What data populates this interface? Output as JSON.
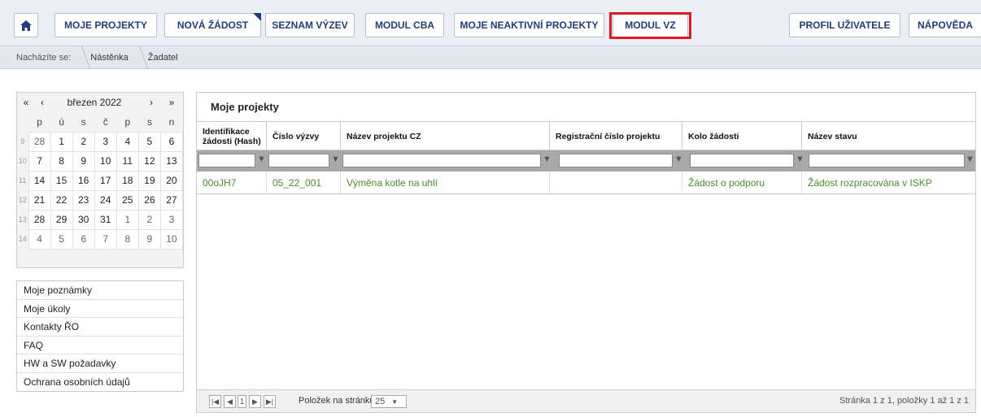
{
  "nav": {
    "home_icon": "home-icon",
    "items": [
      "MOJE PROJEKTY",
      "NOVÁ ŽÁDOST",
      "SEZNAM VÝZEV",
      "MODUL CBA",
      "MOJE NEAKTIVNÍ PROJEKTY",
      "MODUL VZ",
      "PROFIL UŽIVATELE",
      "NÁPOVĚDA"
    ],
    "highlight_color": "#e01b24"
  },
  "breadcrumb": {
    "prefix": "Nacházíte se:",
    "items": [
      "Nástěnka",
      "Žadatel"
    ]
  },
  "calendar": {
    "month": "březen 2022",
    "nav": [
      "«",
      "‹",
      "›",
      "»"
    ],
    "weekdays": [
      "p",
      "ú",
      "s",
      "č",
      "p",
      "s",
      "n"
    ],
    "weeks": [
      {
        "no": "9",
        "days": [
          "28",
          "1",
          "2",
          "3",
          "4",
          "5",
          "6"
        ]
      },
      {
        "no": "10",
        "days": [
          "7",
          "8",
          "9",
          "10",
          "11",
          "12",
          "13"
        ]
      },
      {
        "no": "11",
        "days": [
          "14",
          "15",
          "16",
          "17",
          "18",
          "19",
          "20"
        ]
      },
      {
        "no": "12",
        "days": [
          "21",
          "22",
          "23",
          "24",
          "25",
          "26",
          "27"
        ]
      },
      {
        "no": "13",
        "days": [
          "28",
          "29",
          "30",
          "31",
          "1",
          "2",
          "3"
        ]
      },
      {
        "no": "14",
        "days": [
          "4",
          "5",
          "6",
          "7",
          "8",
          "9",
          "10"
        ]
      }
    ]
  },
  "side_links": [
    "Moje poznámky",
    "Moje úkoly",
    "Kontakty ŘO",
    "FAQ",
    "HW a SW požadavky",
    "Ochrana osobních údajů"
  ],
  "projects": {
    "title": "Moje projekty",
    "columns": [
      "Identifikace žádosti (Hash)",
      "Číslo výzvy",
      "Název projektu CZ",
      "Registrační číslo projektu",
      "Kolo žádosti",
      "Název stavu"
    ],
    "rows": [
      [
        "00oJH7",
        "05_22_001",
        "Výměna kotle na uhlí",
        "",
        "Žádost o podporu",
        "Žádost rozpracována v ISKP"
      ]
    ],
    "pager": {
      "current_page": "1",
      "page_size_label": "Položek na stránku",
      "page_size": "25",
      "summary": "Stránka 1 z 1, položky 1 až 1 z 1"
    },
    "row_color": "#4a8b2c"
  }
}
